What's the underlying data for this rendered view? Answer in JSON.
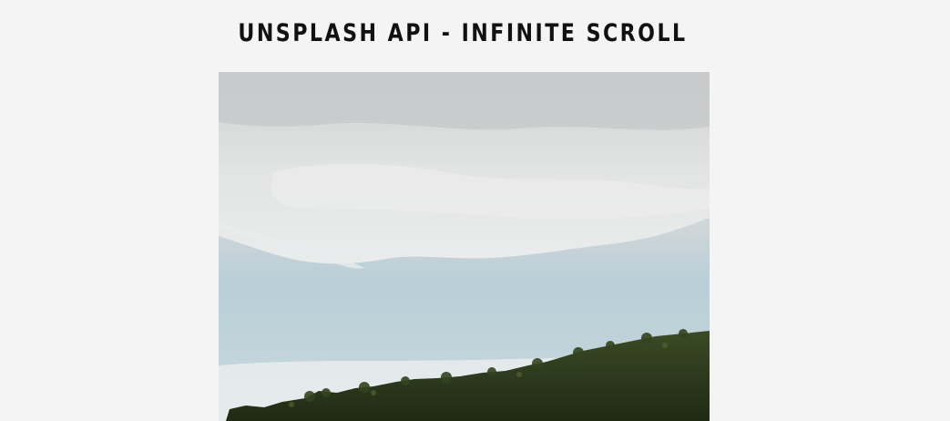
{
  "header": {
    "title": "UNSPLASH API - INFINITE SCROLL"
  },
  "gallery": {
    "images": [
      {
        "subject": "landscape-photo"
      }
    ]
  },
  "colors": {
    "page_background": "#f4f4f4",
    "title_text": "#111111",
    "sky": "#b9cdd6",
    "cloud": "#d9dbdc",
    "hill": "#2c3a1e"
  }
}
